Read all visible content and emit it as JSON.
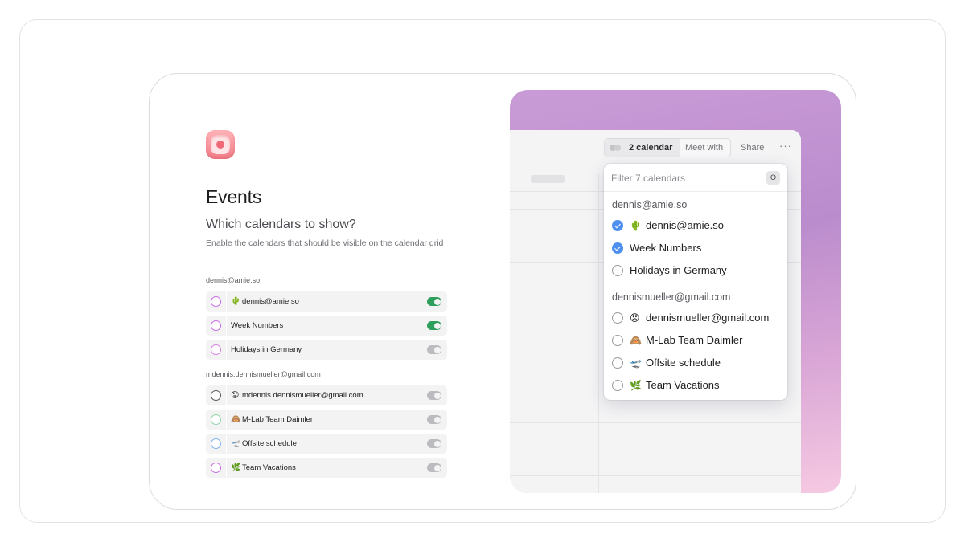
{
  "app": {
    "title": "Events",
    "subtitle": "Which calendars to show?",
    "description": "Enable the calendars that should be visible on the calendar grid"
  },
  "settings": {
    "groups": [
      {
        "label": "dennis@amie.so",
        "items": [
          {
            "emoji": "🌵",
            "label": "dennis@amie.so",
            "enabled": true
          },
          {
            "emoji": "",
            "label": "Week Numbers",
            "enabled": true
          },
          {
            "emoji": "",
            "label": "Holidays in Germany",
            "enabled": false
          }
        ]
      },
      {
        "label": "mdennis.dennismueller@gmail.com",
        "items": [
          {
            "emoji": "😡",
            "label": "mdennis.dennismueller@gmail.com",
            "enabled": false
          },
          {
            "emoji": "🙈",
            "label": "M-Lab Team Daimler",
            "enabled": false
          },
          {
            "emoji": "🛫",
            "label": "Offsite schedule",
            "enabled": false
          },
          {
            "emoji": "🌿",
            "label": "Team Vacations",
            "enabled": false
          }
        ]
      }
    ]
  },
  "toolbar": {
    "calendar_label": "2 calendar",
    "meet_label": "Meet with",
    "share_label": "Share",
    "more_label": "···"
  },
  "popover": {
    "filter_placeholder": "Filter 7 calendars",
    "shortcut_key": "O",
    "groups": [
      {
        "label": "dennis@amie.so",
        "items": [
          {
            "emoji": "🌵",
            "label": "dennis@amie.so",
            "checked": true
          },
          {
            "emoji": "",
            "label": "Week Numbers",
            "checked": true
          },
          {
            "emoji": "",
            "label": "Holidays in Germany",
            "checked": false
          }
        ]
      },
      {
        "label": "dennismueller@gmail.com",
        "items": [
          {
            "emoji": "😡",
            "label": "dennismueller@gmail.com",
            "checked": false
          },
          {
            "emoji": "🙈",
            "label": "M-Lab Team Daimler",
            "checked": false
          },
          {
            "emoji": "🛫",
            "label": "Offsite schedule",
            "checked": false
          },
          {
            "emoji": "🌿",
            "label": "Team Vacations",
            "checked": false
          }
        ]
      }
    ]
  },
  "colors": {
    "accent_green": "#2e9e5b",
    "check_blue": "#4e8ff0",
    "logo_pink": "#f07d87",
    "preview_gradient_top": "#c99bd6",
    "preview_gradient_bottom": "#f6c9e2"
  }
}
